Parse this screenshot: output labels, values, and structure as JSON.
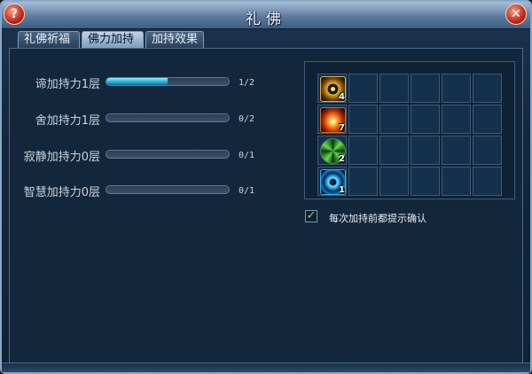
{
  "window": {
    "title": "礼佛",
    "help_label": "?",
    "close_label": "✕"
  },
  "tabs": [
    {
      "label": "礼佛祈福",
      "active": false
    },
    {
      "label": "佛力加持",
      "active": true
    },
    {
      "label": "加持效果",
      "active": false
    }
  ],
  "blessings": [
    {
      "label": "谛加持力1层",
      "count": "1/2",
      "progress": 0.5
    },
    {
      "label": "舍加持力1层",
      "count": "0/2",
      "progress": 0
    },
    {
      "label": "寂静加持力0层",
      "count": "0/1",
      "progress": 0
    },
    {
      "label": "智慧加持力0层",
      "count": "0/1",
      "progress": 0
    }
  ],
  "items": [
    {
      "icon": "golden-ring-icon",
      "qty": "4"
    },
    {
      "icon": "flame-crown-icon",
      "qty": "7"
    },
    {
      "icon": "green-spiral-icon",
      "qty": "2"
    },
    {
      "icon": "blue-orb-icon",
      "qty": "1"
    }
  ],
  "confirm_option": {
    "label": "每次加持前都提示确认",
    "checked": true
  },
  "colors": {
    "accent": "#22a7d8",
    "check": "#5fe55a"
  }
}
